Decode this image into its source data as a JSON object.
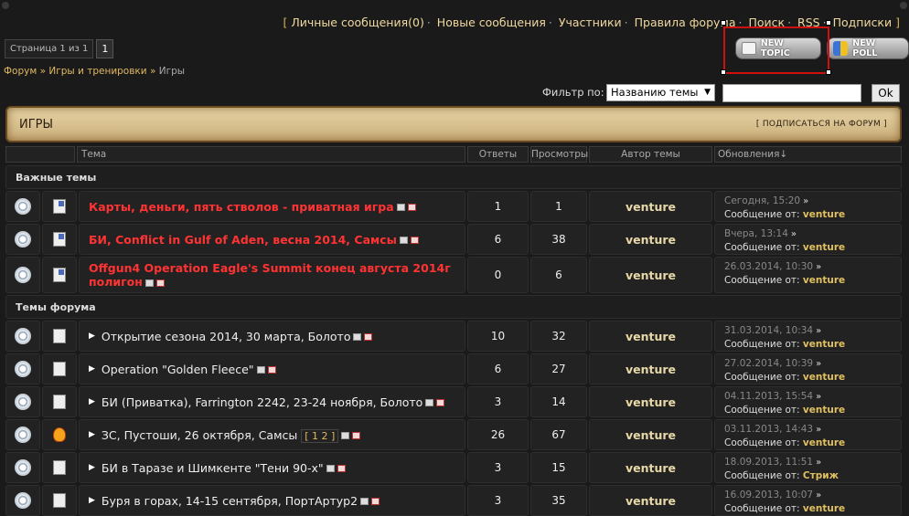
{
  "nav": {
    "bracket_open": "[",
    "bracket_close": "]",
    "items": [
      "Личные сообщения(0)",
      "Новые сообщения",
      "Участники",
      "Правила форума",
      "Поиск",
      "RSS",
      "Подписки"
    ]
  },
  "pager": {
    "info": "Страница 1 из 1",
    "current": "1"
  },
  "breadcrumb": {
    "items": [
      "Форум",
      "Игры и тренировки"
    ],
    "sep": "»",
    "current": "Игры"
  },
  "buttons": {
    "new_topic": "NEW TOPIC",
    "new_poll": "NEW POLL"
  },
  "filter": {
    "label": "Фильтр по:",
    "option": "Названию темы",
    "ok": "Ok"
  },
  "forum": {
    "title": "ИГРЫ",
    "subscribe": "[ ПОДПИСАТЬСЯ НА ФОРУМ ]"
  },
  "columns": {
    "topic": "Тема",
    "replies": "Ответы",
    "views": "Просмотры",
    "author": "Автор темы",
    "updates": "Обновления↓"
  },
  "sections": {
    "important": "Важные темы",
    "topics": "Темы форума"
  },
  "by_label": "Сообщение от:",
  "rows": [
    {
      "title": "Карты, деньги, пять стволов - приватная игра",
      "replies": "1",
      "views": "1",
      "author": "venture",
      "date": "Сегодня, 15:20",
      "last": "venture"
    },
    {
      "title": "БИ, Conflict in Gulf of Aden, весна 2014, Самсы",
      "replies": "6",
      "views": "38",
      "author": "venture",
      "date": "Вчера, 13:14",
      "last": "venture"
    },
    {
      "title": "Offgun4 Operation Eagle's Summit конец августа 2014г полигон",
      "replies": "0",
      "views": "6",
      "author": "venture",
      "date": "26.03.2014, 10:30",
      "last": "venture"
    },
    {
      "title": "Открытие сезона 2014, 30 марта, Болото",
      "replies": "10",
      "views": "32",
      "author": "venture",
      "date": "31.03.2014, 10:34",
      "last": "venture"
    },
    {
      "title": "Operation \"Golden Fleece\"",
      "replies": "6",
      "views": "27",
      "author": "venture",
      "date": "27.02.2014, 10:39",
      "last": "venture"
    },
    {
      "title": "БИ (Приватка), Farrington 2242, 23-24 ноября, Болото",
      "replies": "3",
      "views": "14",
      "author": "venture",
      "date": "04.11.2013, 15:54",
      "last": "venture"
    },
    {
      "title": "ЗС, Пустоши, 26 октября, Самсы",
      "pages": "[ 1 2 ]",
      "replies": "26",
      "views": "67",
      "author": "venture",
      "date": "03.11.2013, 14:43",
      "last": "venture"
    },
    {
      "title": "БИ в Таразе и Шимкенте \"Тени 90-х\"",
      "replies": "3",
      "views": "15",
      "author": "venture",
      "date": "18.09.2013, 11:51",
      "last": "Стриж"
    },
    {
      "title": "Буря в горах, 14-15 сентября, ПортАртур2",
      "replies": "3",
      "views": "35",
      "author": "venture",
      "date": "16.09.2013, 10:07",
      "last": "venture"
    }
  ]
}
